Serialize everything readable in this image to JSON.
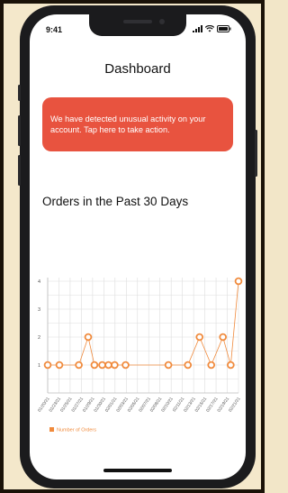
{
  "status": {
    "time": "9:41"
  },
  "app": {
    "title": "Dashboard",
    "alert_text": "We have detected unusual activity on your account. Tap here to take action.",
    "section_title": "Orders in the Past 30 Days"
  },
  "colors": {
    "accent": "#e8533f",
    "series": "#f08a3c",
    "grid": "#dddddd"
  },
  "chart_data": {
    "type": "line",
    "title": "",
    "xlabel": "",
    "ylabel": "",
    "ylim": [
      0,
      4
    ],
    "yticks": [
      1,
      2,
      3,
      4
    ],
    "x_tick_labels": [
      "01/20/21",
      "01/23/21",
      "01/25/21",
      "01/27/21",
      "01/29/21",
      "01/30/21",
      "02/01/21",
      "02/03/21",
      "02/05/21",
      "02/07/21",
      "02/08/21",
      "02/10/21",
      "02/11/21",
      "02/13/21",
      "02/15/21",
      "02/17/21",
      "02/19/21",
      "02/21/21"
    ],
    "legend": "Number of Orders",
    "series": [
      {
        "name": "Number of Orders",
        "points": [
          {
            "x": 0,
            "y": 1
          },
          {
            "x": 1.5,
            "y": 1
          },
          {
            "x": 4,
            "y": 1
          },
          {
            "x": 5.2,
            "y": 2
          },
          {
            "x": 6,
            "y": 1
          },
          {
            "x": 7,
            "y": 1
          },
          {
            "x": 7.8,
            "y": 1
          },
          {
            "x": 8.6,
            "y": 1
          },
          {
            "x": 10,
            "y": 1
          },
          {
            "x": 15.5,
            "y": 1
          },
          {
            "x": 18,
            "y": 1
          },
          {
            "x": 19.5,
            "y": 2
          },
          {
            "x": 21,
            "y": 1
          },
          {
            "x": 22.5,
            "y": 2
          },
          {
            "x": 23.5,
            "y": 1
          },
          {
            "x": 24.5,
            "y": 4
          }
        ]
      }
    ],
    "xlim": [
      0,
      24.5
    ]
  }
}
